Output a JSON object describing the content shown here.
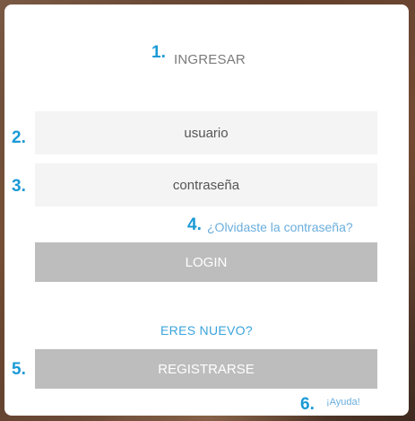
{
  "login_card": {
    "title": "INGRESAR",
    "username_placeholder": "usuario",
    "password_placeholder": "contraseña",
    "forgot_password_link": "¿Olvidaste la contraseña?",
    "login_button": "LOGIN",
    "new_user_prompt": "ERES NUEVO?",
    "register_button": "REGISTRARSE",
    "help_link": "¡Ayuda!"
  },
  "annotations": {
    "n1": "1.",
    "n2": "2.",
    "n3": "3.",
    "n4": "4.",
    "n5": "5.",
    "n6": "6."
  },
  "colors": {
    "annotation_number": "#1a9ad6",
    "link": "#6aaedc",
    "button_bg": "#bdbdbd",
    "field_bg": "#f4f4f4"
  }
}
